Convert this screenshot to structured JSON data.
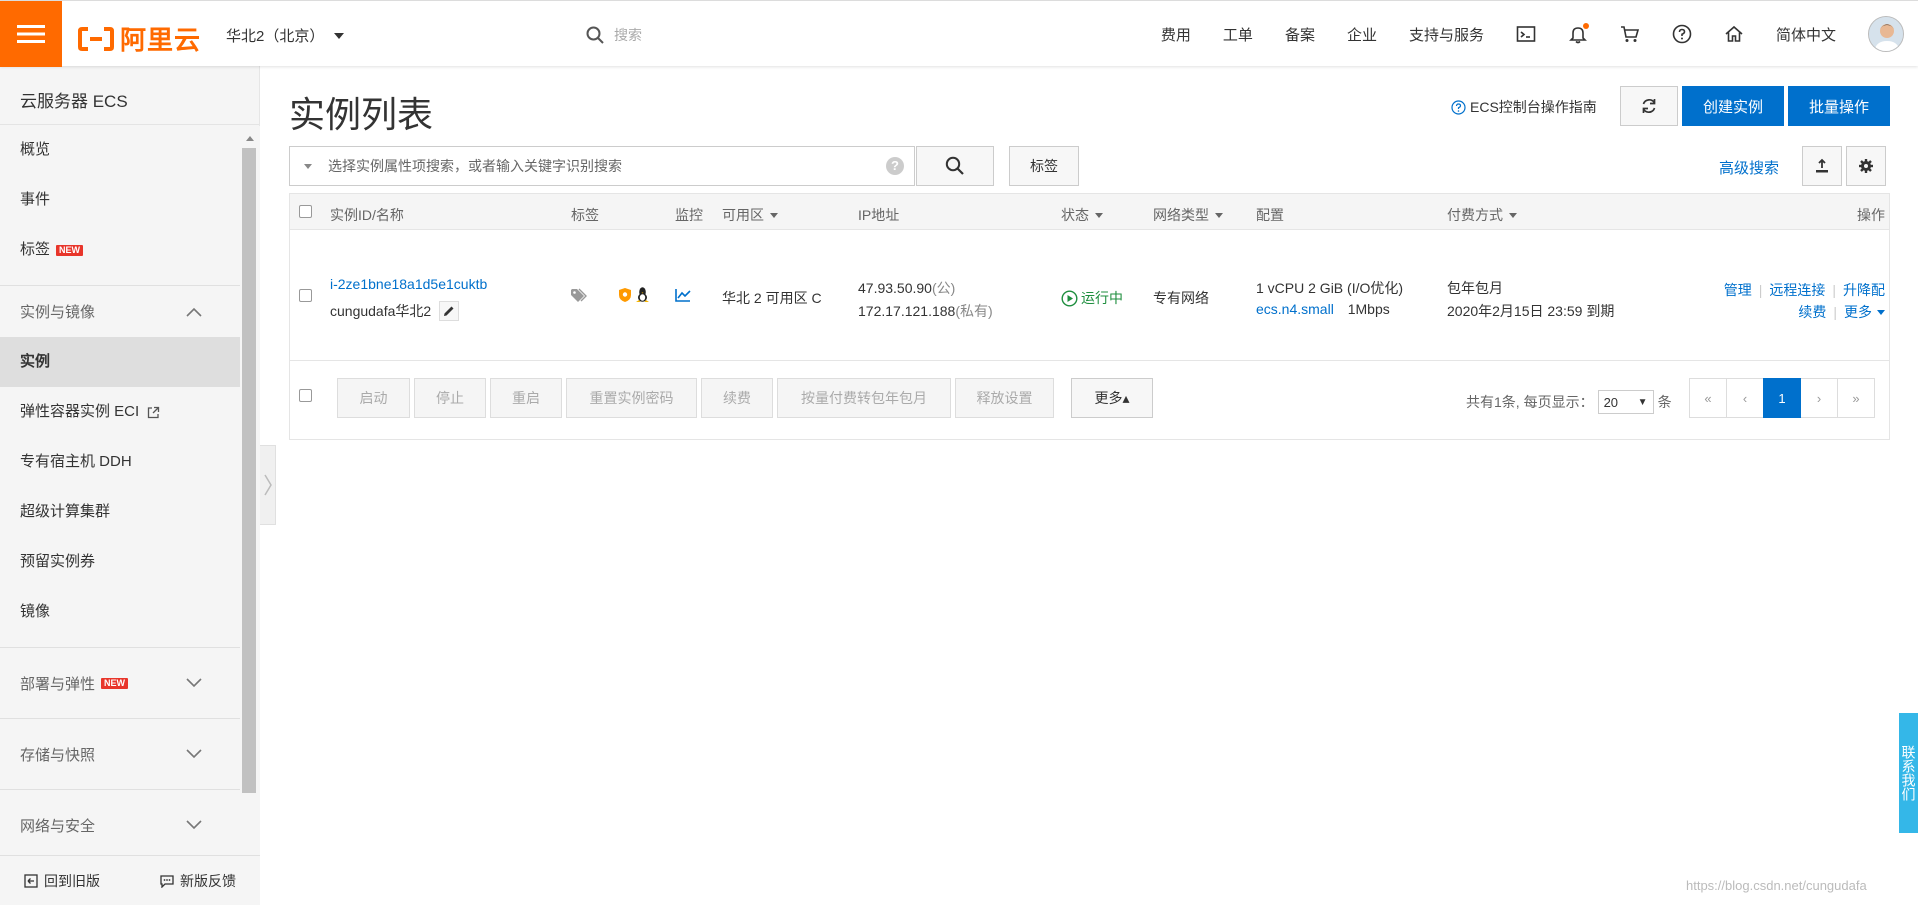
{
  "topbar": {
    "logo_text": "阿里云",
    "region": "华北2（北京）",
    "search_placeholder": "搜索",
    "nav": [
      "费用",
      "工单",
      "备案",
      "企业",
      "支持与服务"
    ],
    "language": "简体中文"
  },
  "sidebar": {
    "title": "云服务器 ECS",
    "items_top": [
      {
        "label": "概览"
      },
      {
        "label": "事件"
      },
      {
        "label": "标签",
        "badge": "NEW"
      }
    ],
    "group_instances": "实例与镜像",
    "items_instances": [
      {
        "label": "实例",
        "active": true
      },
      {
        "label": "弹性容器实例 ECI"
      },
      {
        "label": "专有宿主机 DDH"
      },
      {
        "label": "超级计算集群"
      },
      {
        "label": "预留实例券"
      },
      {
        "label": "镜像"
      }
    ],
    "groups": [
      {
        "label": "部署与弹性",
        "badge": "NEW"
      },
      {
        "label": "存储与快照"
      },
      {
        "label": "网络与安全"
      }
    ],
    "bottom": {
      "old_version": "回到旧版",
      "feedback": "新版反馈"
    }
  },
  "main": {
    "title": "实例列表",
    "guide_link": "ECS控制台操作指南",
    "create_button": "创建实例",
    "batch_button": "批量操作",
    "search_placeholder": "选择实例属性项搜索，或者输入关键字识别搜索",
    "tag_button": "标签",
    "advanced_search": "高级搜索"
  },
  "table": {
    "headers": {
      "id_name": "实例ID/名称",
      "tags": "标签",
      "monitor": "监控",
      "zone": "可用区",
      "ip": "IP地址",
      "status": "状态",
      "network": "网络类型",
      "config": "配置",
      "billing": "付费方式",
      "actions": "操作"
    },
    "row": {
      "id": "i-2ze1bne18a1d5e1cuktb",
      "name": "cungudafa华北2",
      "zone": "华北 2 可用区 C",
      "public_ip": "47.93.50.90",
      "public_label": "(公)",
      "private_ip": "172.17.121.188",
      "private_label": "(私有)",
      "status": "运行中",
      "network": "专有网络",
      "config_spec": "1 vCPU 2 GiB (I/O优化)",
      "config_type": "ecs.n4.small",
      "bandwidth": "1Mbps",
      "billing_type": "包年包月",
      "expire": "2020年2月15日 23:59 到期",
      "actions": {
        "manage": "管理",
        "remote": "远程连接",
        "upgrade": "升降配",
        "renew": "续费",
        "more": "更多"
      }
    },
    "footer": {
      "buttons": [
        "启动",
        "停止",
        "重启",
        "重置实例密码",
        "续费",
        "按量付费转包年包月",
        "释放设置"
      ],
      "more": "更多▴",
      "total_text": "共有1条, 每页显示：",
      "page_size": "20",
      "unit": "条",
      "pages": [
        "«",
        "‹",
        "1",
        "›",
        "»"
      ]
    }
  },
  "float_contact": "联系我们",
  "watermark": "https://blog.csdn.net/cungudafa",
  "colors": {
    "brand": "#ff6a00",
    "primary": "#0070cc",
    "running": "#1e8e3e",
    "new_badge": "#e8352a"
  }
}
